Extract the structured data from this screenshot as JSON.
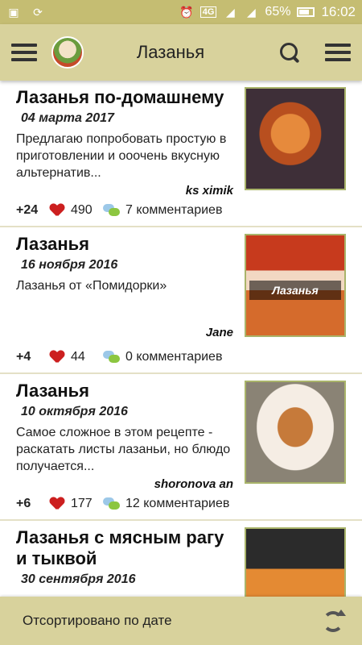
{
  "status_bar": {
    "network": "4G",
    "battery": "65%",
    "time": "16:02"
  },
  "toolbar": {
    "title": "Лазанья",
    "icons": [
      "menu-icon",
      "chef-logo",
      "search-icon",
      "more-menu-icon"
    ]
  },
  "recipes": [
    {
      "title": "Лазанья по-домашнему",
      "date": "04 марта 2017",
      "description": "Предлагаю попробовать простую в приготовлении и ооочень вкусную альтернатив...",
      "author": "ks ximik",
      "score": "+24",
      "likes": "490",
      "comments": "7 комментариев"
    },
    {
      "title": "Лазанья",
      "date": "16 ноября 2016",
      "description": "Лазанья от «Помидорки»",
      "author": "Jane",
      "score": "+4",
      "likes": "44",
      "comments": "0 комментариев",
      "image_caption": "Лазанья"
    },
    {
      "title": "Лазанья",
      "date": "10 октября 2016",
      "description": "Самое сложное в этом рецепте - раскатать листы лазаньи, но блюдо получается...",
      "author": "shoronova an",
      "score": "+6",
      "likes": "177",
      "comments": "12 комментариев"
    },
    {
      "title": "Лазанья с мясным рагу и тыквой",
      "date": "30 сентября 2016"
    }
  ],
  "bottom_bar": {
    "sort_label": "Отсортировано по дате"
  },
  "colors": {
    "header": "#d8d29c",
    "status_bar": "#c5bd72",
    "thumb_border": "#a9b46a",
    "heart": "#cc1f1f"
  }
}
